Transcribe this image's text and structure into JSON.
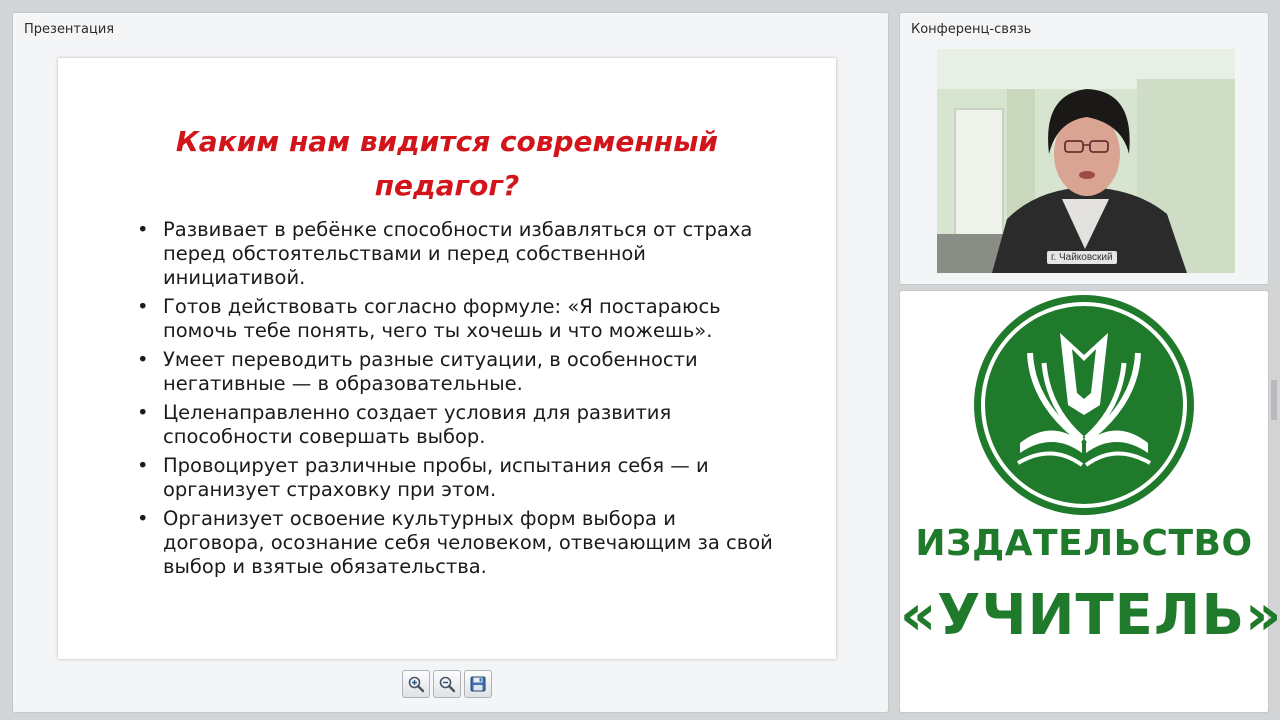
{
  "presentation": {
    "panel_title": "Презентация",
    "slide": {
      "title_line1": "Каким нам видится современный",
      "title_line2": "педагог?",
      "bullets": [
        "Развивает в ребёнке способности избавляться от страха перед обстоятельствами и перед собственной инициативой.",
        "Готов  действовать согласно формуле: «Я постараюсь помочь тебе понять, чего ты хочешь и что можешь».",
        "Умеет переводить разные ситуации, в особенности негативные — в образовательные.",
        "Целенаправленно создает условия для развития способности совершать выбор.",
        "Провоцирует различные пробы, испытания себя — и организует страховку при этом.",
        "Организует освоение культурных форм выбора и договора, осознание себя человеком, отвечающим за свой выбор и взятые обязательства."
      ]
    },
    "toolbar": {
      "zoom_in_icon": "zoom-in-icon",
      "zoom_out_icon": "zoom-out-icon",
      "save_icon": "floppy-disk-icon"
    }
  },
  "conference": {
    "panel_title": "Конференц-связь",
    "video_caption": "г. Чайковский"
  },
  "publisher": {
    "line1": "ИЗДАТЕЛЬСТВО",
    "line2": "«УЧИТЕЛЬ»",
    "brand_color": "#1f7a2b"
  },
  "colors": {
    "slide_title": "#d2141b",
    "page_background": "#d2d4d6"
  }
}
